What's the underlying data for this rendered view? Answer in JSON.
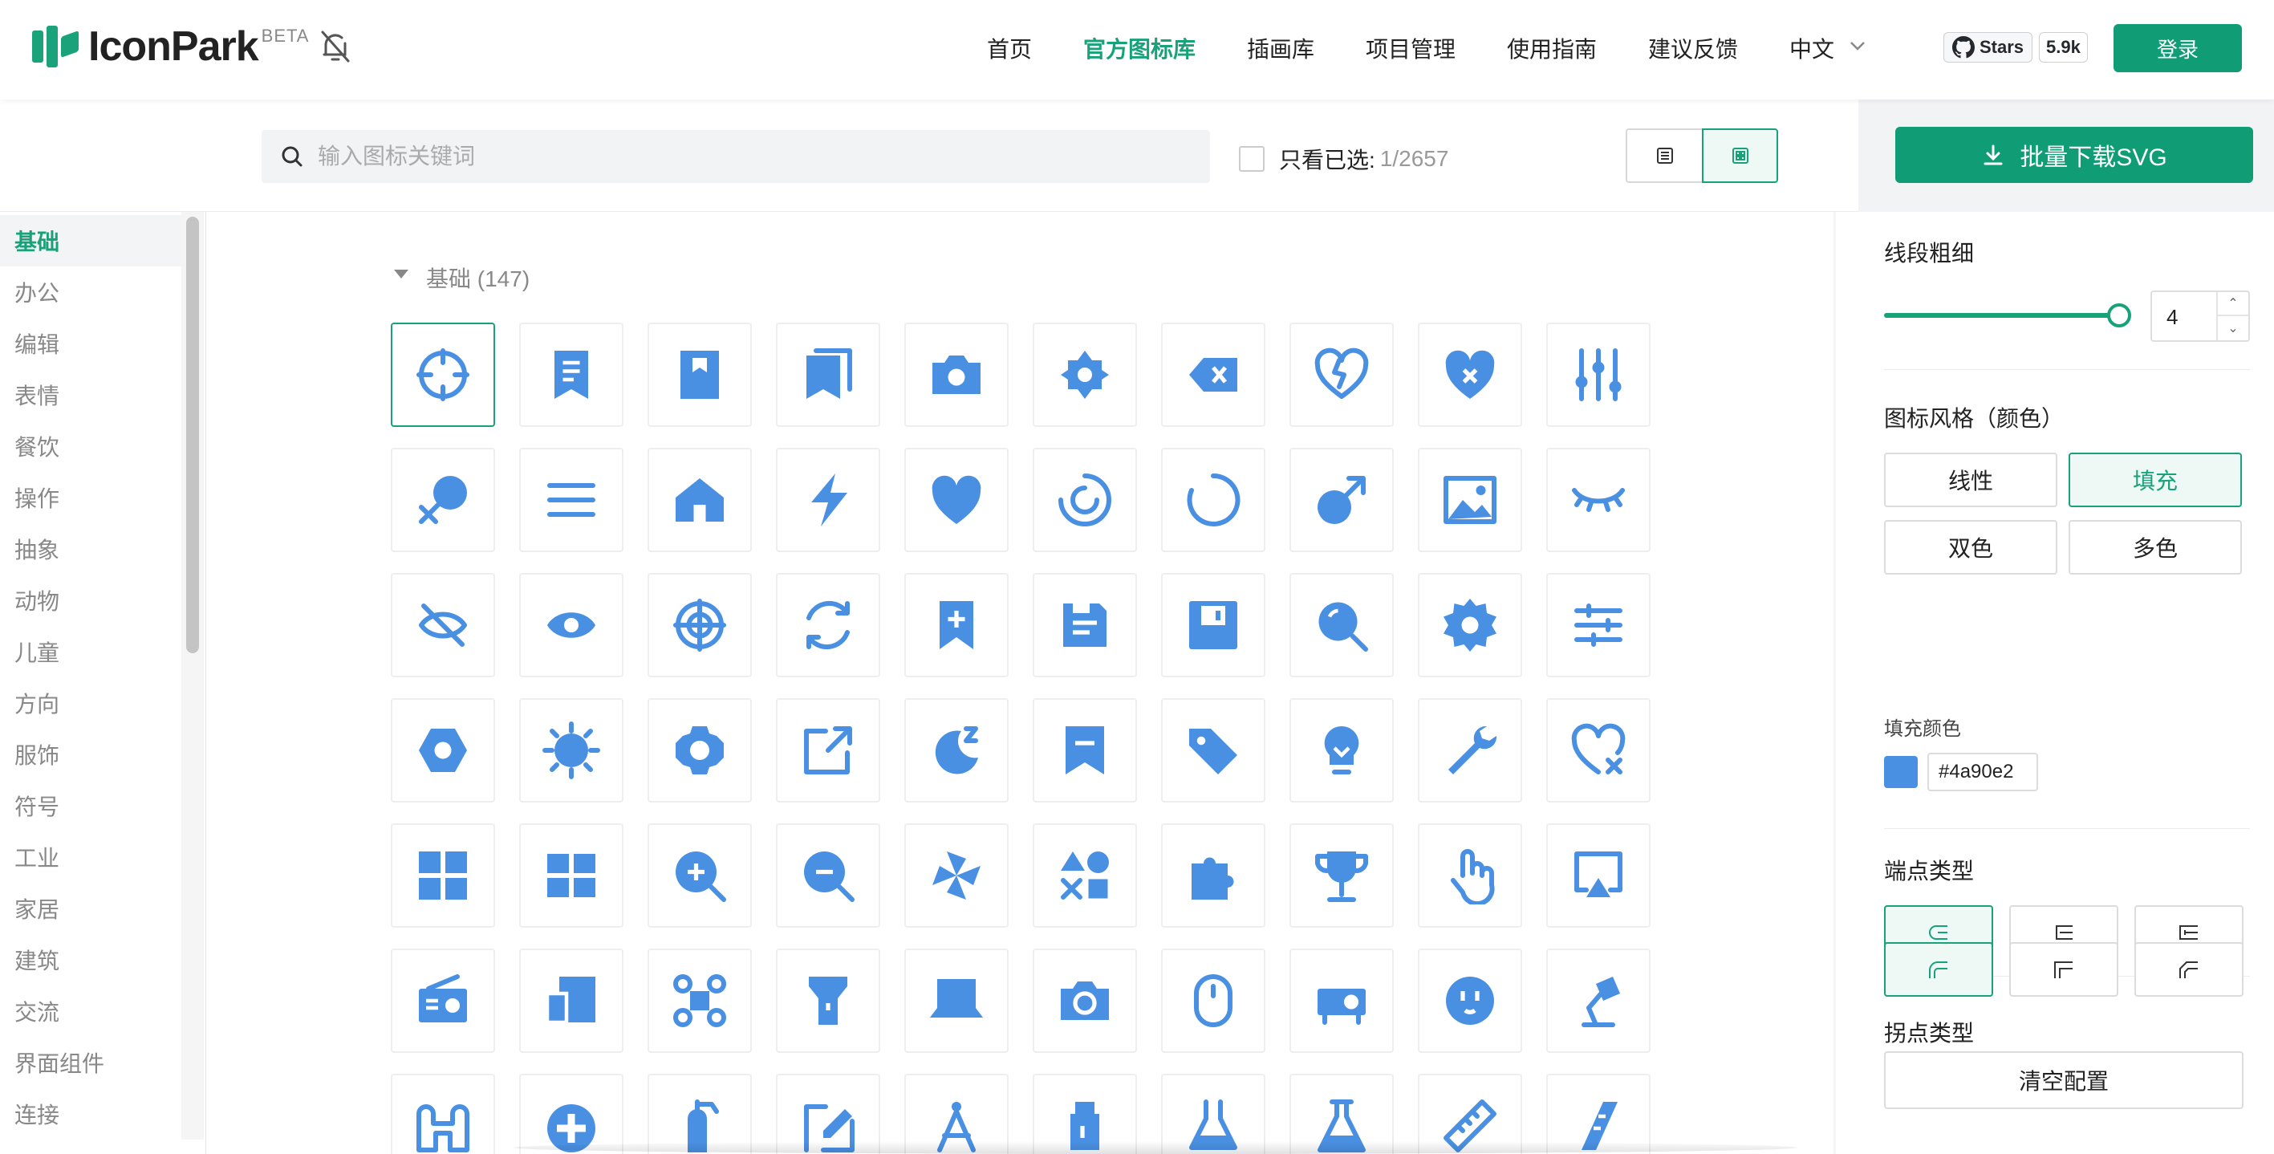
{
  "brand": {
    "name": "IconPark",
    "badge": "BETA"
  },
  "nav": {
    "items": [
      "首页",
      "官方图标库",
      "插画库",
      "项目管理",
      "使用指南",
      "建议反馈"
    ],
    "active": "官方图标库",
    "language": "中文",
    "github_stars_label": "Stars",
    "github_stars_count": "5.9k",
    "login_label": "登录"
  },
  "search": {
    "placeholder": "输入图标关键词",
    "only_selected_label": "只看已选:",
    "selected_count": "1/2657"
  },
  "sidebar": {
    "items": [
      "基础",
      "办公",
      "编辑",
      "表情",
      "餐饮",
      "操作",
      "抽象",
      "动物",
      "儿童",
      "方向",
      "服饰",
      "符号",
      "工业",
      "家居",
      "建筑",
      "交流",
      "界面组件",
      "连接"
    ],
    "active": "基础"
  },
  "main": {
    "group_title": "基础 (147)",
    "icon_color": "#4a90e2",
    "icons": [
      "aiming-icon",
      "doc-detail-icon",
      "bookmark-icon",
      "bookmark-multi-icon",
      "camera-icon",
      "brightness-icon",
      "delete-key-icon",
      "broken-heart-icon",
      "heart-x-icon",
      "tuning-icon",
      "female-icon",
      "hamburger-icon",
      "home-icon",
      "lightning-icon",
      "heart-icon",
      "loading-ring-icon",
      "loading-icon",
      "male-icon",
      "picture-icon",
      "preview-close-one-icon",
      "preview-close-icon",
      "preview-open-icon",
      "target-icon",
      "refresh-icon",
      "bookmark-plus-icon",
      "save-icon",
      "save-one-icon",
      "search-icon",
      "setting-icon",
      "setting-two-icon",
      "hexagon-icon",
      "sun-icon",
      "setting-three-icon",
      "share-icon",
      "sleep-icon",
      "tag-one-icon",
      "tag-icon",
      "bulb-icon",
      "wrench-icon",
      "heart-broken-x-icon",
      "app-grid-icon",
      "app-grid-two-icon",
      "zoom-in-icon",
      "zoom-out-icon",
      "windmill-icon",
      "shapes-icon",
      "puzzle-icon",
      "trophy-icon",
      "hand-pointer-icon",
      "airplay-icon",
      "radio-icon",
      "devices-icon",
      "drone-icon",
      "flashlight-icon",
      "laptop-icon",
      "camera-two-icon",
      "mouse-icon",
      "projector-icon",
      "socket-icon",
      "desk-lamp-icon",
      "binoculars-icon",
      "first-aid-icon",
      "fire-extinguisher-icon",
      "edit-icon",
      "compasses-icon",
      "lantern-icon",
      "flask-icon",
      "flask-two-icon",
      "ruler-icon",
      "ruler-two-icon"
    ],
    "selected_index": 0
  },
  "panel": {
    "download_label": "批量下载SVG",
    "stroke_label": "线段粗细",
    "stroke_value": "4",
    "stroke_level": 4,
    "style_label": "图标风格（颜色）",
    "styles": [
      "线性",
      "填充",
      "双色",
      "多色"
    ],
    "active_style": "填充",
    "fill_color_label": "填充颜色",
    "fill_color_value": "#4a90e2",
    "cap_label": "端点类型",
    "join_label": "拐点类型",
    "clear_label": "清空配置",
    "accent": "#18a27a"
  }
}
